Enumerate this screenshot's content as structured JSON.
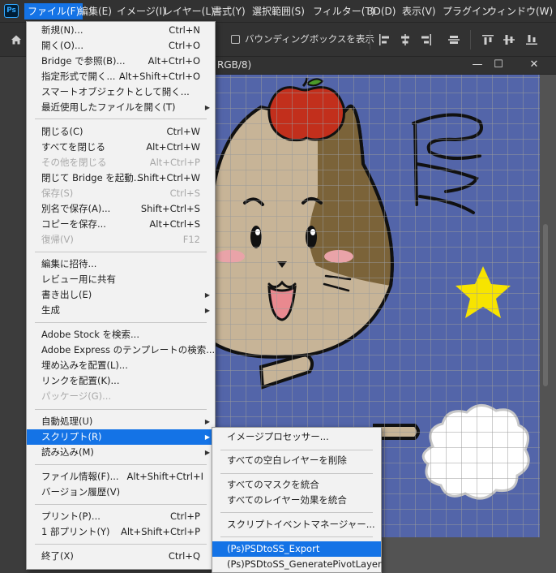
{
  "app": {
    "logo_text": "Ps"
  },
  "menubar": {
    "items": [
      {
        "label": "ファイル(F)"
      },
      {
        "label": "編集(E)"
      },
      {
        "label": "イメージ(I)"
      },
      {
        "label": "レイヤー(L)"
      },
      {
        "label": "書式(Y)"
      },
      {
        "label": "選択範囲(S)"
      },
      {
        "label": "フィルター(T)"
      },
      {
        "label": "3D(D)"
      },
      {
        "label": "表示(V)"
      },
      {
        "label": "プラグイン"
      },
      {
        "label": "ウィンドウ(W)"
      }
    ]
  },
  "options_bar": {
    "bounding_box_label": "バウンディングボックスを表示",
    "bounding_box_checked": false,
    "icons": [
      "home-icon",
      "align-left-icon",
      "align-center-horizontal-icon",
      "align-right-icon",
      "align-middle-icon",
      "align-top-icon",
      "align-vertical-center-icon",
      "align-bottom-icon"
    ]
  },
  "document": {
    "title_fragment": "RGB/8)",
    "minimize": "—",
    "maximize": "☐",
    "close": "✕",
    "colors": {
      "background": "#5365a9",
      "grid": "#9a9a9a",
      "apple": "#c22f1c",
      "star": "#f7e400",
      "cat_fur": "#c7b497",
      "cat_patch": "#7b6339"
    }
  },
  "file_menu": {
    "items": [
      {
        "label": "新規(N)...",
        "shortcut": "Ctrl+N"
      },
      {
        "label": "開く(O)...",
        "shortcut": "Ctrl+O"
      },
      {
        "label": "Bridge で参照(B)...",
        "shortcut": "Alt+Ctrl+O"
      },
      {
        "label": "指定形式で開く...",
        "shortcut": "Alt+Shift+Ctrl+O"
      },
      {
        "label": "スマートオブジェクトとして開く...",
        "shortcut": ""
      },
      {
        "label": "最近使用したファイルを開く(T)",
        "shortcut": ""
      },
      {
        "label": "閉じる(C)",
        "shortcut": "Ctrl+W"
      },
      {
        "label": "すべてを閉じる",
        "shortcut": "Alt+Ctrl+W"
      },
      {
        "label": "その他を閉じる",
        "shortcut": "Alt+Ctrl+P"
      },
      {
        "label": "閉じて Bridge を起動...",
        "shortcut": "Shift+Ctrl+W"
      },
      {
        "label": "保存(S)",
        "shortcut": "Ctrl+S"
      },
      {
        "label": "別名で保存(A)...",
        "shortcut": "Shift+Ctrl+S"
      },
      {
        "label": "コピーを保存...",
        "shortcut": "Alt+Ctrl+S"
      },
      {
        "label": "復帰(V)",
        "shortcut": "F12"
      },
      {
        "label": "編集に招待...",
        "shortcut": ""
      },
      {
        "label": "レビュー用に共有",
        "shortcut": ""
      },
      {
        "label": "書き出し(E)",
        "shortcut": ""
      },
      {
        "label": "生成",
        "shortcut": ""
      },
      {
        "label": "Adobe Stock を検索...",
        "shortcut": ""
      },
      {
        "label": "Adobe Express のテンプレートの検索...",
        "shortcut": ""
      },
      {
        "label": "埋め込みを配置(L)...",
        "shortcut": ""
      },
      {
        "label": "リンクを配置(K)...",
        "shortcut": ""
      },
      {
        "label": "パッケージ(G)...",
        "shortcut": ""
      },
      {
        "label": "自動処理(U)",
        "shortcut": ""
      },
      {
        "label": "スクリプト(R)",
        "shortcut": ""
      },
      {
        "label": "読み込み(M)",
        "shortcut": ""
      },
      {
        "label": "ファイル情報(F)...",
        "shortcut": "Alt+Shift+Ctrl+I"
      },
      {
        "label": "バージョン履歴(V)",
        "shortcut": ""
      },
      {
        "label": "プリント(P)...",
        "shortcut": "Ctrl+P"
      },
      {
        "label": "1 部プリント(Y)",
        "shortcut": "Alt+Shift+Ctrl+P"
      },
      {
        "label": "終了(X)",
        "shortcut": "Ctrl+Q"
      }
    ]
  },
  "script_menu": {
    "items": [
      {
        "label": "イメージプロセッサー..."
      },
      {
        "label": "すべての空白レイヤーを削除"
      },
      {
        "label": "すべてのマスクを統合"
      },
      {
        "label": "すべてのレイヤー効果を統合"
      },
      {
        "label": "スクリプトイベントマネージャー..."
      },
      {
        "label": "(Ps)PSDtoSS_Export"
      },
      {
        "label": "(Ps)PSDtoSS_GeneratePivotLayer"
      }
    ]
  }
}
